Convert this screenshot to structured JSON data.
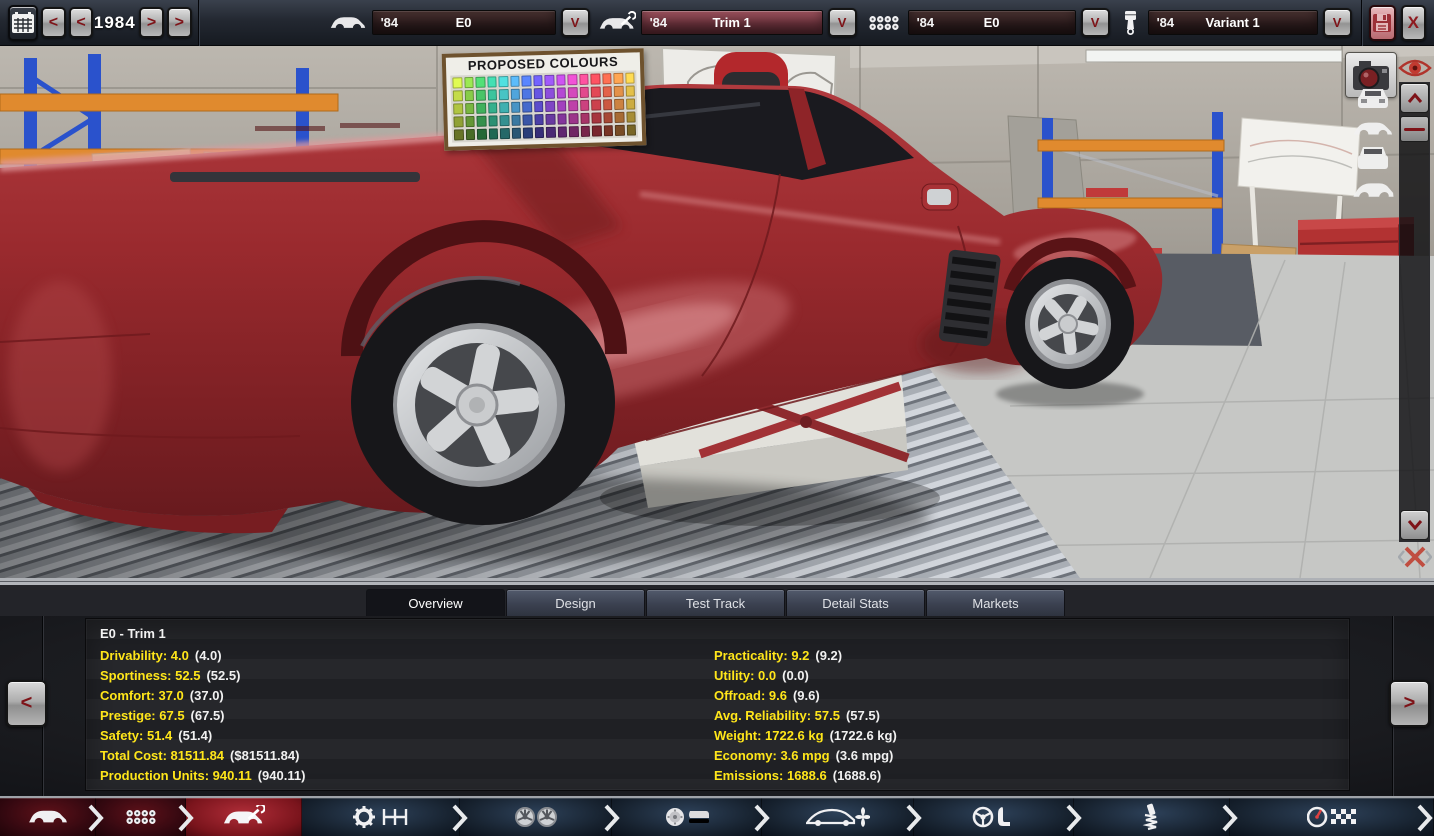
{
  "topbar": {
    "year": "1984",
    "prev_fast": "<",
    "prev": "<",
    "next": ">",
    "next_fast": ">",
    "dropdown_glyph": "V",
    "close_glyph": "X",
    "selectors": [
      {
        "era": "'84",
        "name": "E0"
      },
      {
        "era": "'84",
        "name": "Trim 1"
      },
      {
        "era": "'84",
        "name": "E0"
      },
      {
        "era": "'84",
        "name": "Variant 1"
      }
    ]
  },
  "viewport": {
    "poster": {
      "title": "PROPOSED COLOURS",
      "rows": 5,
      "cols": 16,
      "row_brightness": [
        1.12,
        0.98,
        0.88,
        0.72,
        0.52
      ],
      "swatch_colors": [
        "#c8e04a",
        "#8ad04a",
        "#4ac86a",
        "#3cc8a0",
        "#48c8c8",
        "#52a8e0",
        "#5078e8",
        "#6858e8",
        "#9050e0",
        "#b84ad8",
        "#d84ac0",
        "#e84a90",
        "#e84a58",
        "#e8644a",
        "#e8944a",
        "#e8c44a"
      ]
    },
    "icons": [
      "camera-icon",
      "visibility-eye-icon",
      "view-front-icon",
      "view-side-icon",
      "view-rear-icon",
      "view-perspective-icon",
      "scroll-up-icon",
      "scroll-down-icon",
      "photo-gizmo-icon"
    ],
    "car_color": "#9e2b2e"
  },
  "panel": {
    "tabs": [
      {
        "label": "Overview",
        "active": true
      },
      {
        "label": "Design",
        "active": false
      },
      {
        "label": "Test Track",
        "active": false
      },
      {
        "label": "Detail Stats",
        "active": false
      },
      {
        "label": "Markets",
        "active": false
      }
    ],
    "header": "E0 - Trim 1",
    "stats_left": [
      {
        "text": "Drivability: 4.0",
        "paren": "(4.0)"
      },
      {
        "text": "Sportiness: 52.5",
        "paren": "(52.5)"
      },
      {
        "text": "Comfort: 37.0",
        "paren": "(37.0)"
      },
      {
        "text": "Prestige: 67.5",
        "paren": "(67.5)"
      },
      {
        "text": "Safety: 51.4",
        "paren": "(51.4)"
      },
      {
        "text": "Total Cost: 81511.84",
        "paren": "($81511.84)"
      },
      {
        "text": "Production Units: 940.11",
        "paren": "(940.11)"
      }
    ],
    "stats_right": [
      {
        "text": "Practicality: 9.2",
        "paren": "(9.2)"
      },
      {
        "text": "Utility: 0.0",
        "paren": "(0.0)"
      },
      {
        "text": "Offroad: 9.6",
        "paren": "(9.6)"
      },
      {
        "text": "Avg. Reliability: 57.5",
        "paren": "(57.5)"
      },
      {
        "text": "Weight: 1722.6 kg",
        "paren": "(1722.6 kg)"
      },
      {
        "text": "Economy: 3.6 mpg",
        "paren": "(3.6 mpg)"
      },
      {
        "text": "Emissions: 1688.6",
        "paren": "(1688.6)"
      }
    ],
    "prev_arrow": "<",
    "next_arrow": ">"
  },
  "toolbar": {
    "steps": [
      "model",
      "engine-family",
      "trim",
      "gearbox",
      "wheels",
      "brakes",
      "body-aero",
      "interior",
      "suspension",
      "test-track"
    ],
    "active_step": "trim"
  },
  "colors": {
    "stat_yellow": "#ffe61a",
    "toolbar_red": "#5e1119",
    "toolbar_active_red": "#b02d38",
    "toolbar_navy": "#2d4159",
    "field_highlight": "#9a515c"
  }
}
